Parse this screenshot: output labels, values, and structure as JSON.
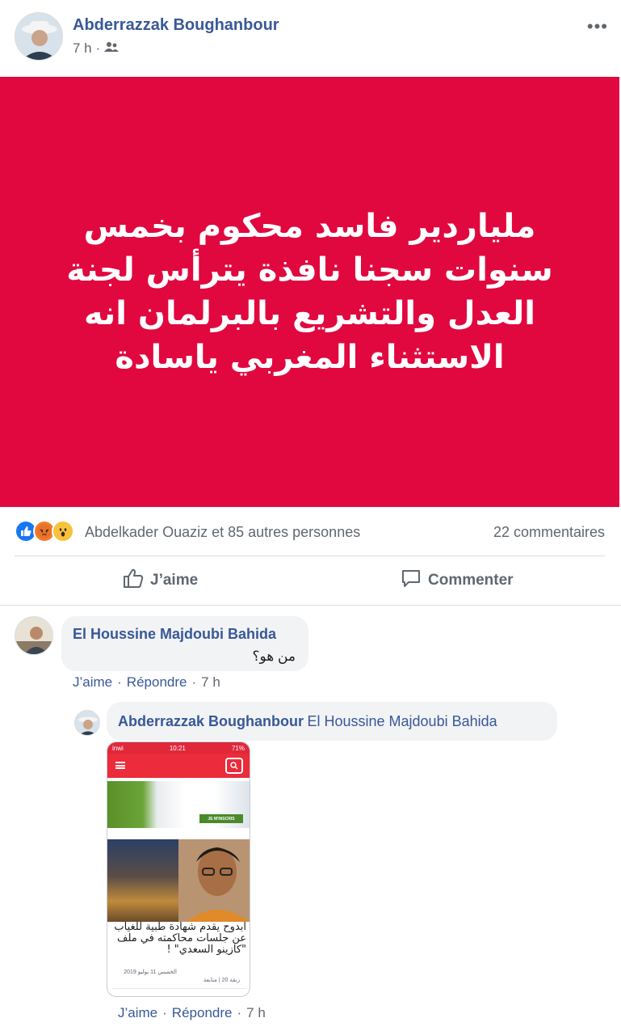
{
  "post": {
    "author": "Abderrazzak Boughanbour",
    "time": "7 h",
    "separator": "·",
    "more_label": "•••",
    "banner_text": "ملياردير فاسد محكوم بخمس سنوات سجنا نافذة يترأس لجنة العدل والتشريع بالبرلمان انه الاستثناء المغربي ياسادة"
  },
  "reactions": {
    "icons": [
      "like-icon",
      "angry-icon",
      "wow-icon"
    ],
    "summary": "Abdelkader Ouaziz et 85 autres personnes",
    "comments_count": "22 commentaires"
  },
  "actions": {
    "like_label": "J’aime",
    "comment_label": "Commenter"
  },
  "comments": [
    {
      "author": "El Houssine Majdoubi Bahida",
      "text": "من هو؟",
      "like": "J’aime",
      "reply": "Répondre",
      "time": "7 h",
      "separator": "·"
    }
  ],
  "reply": {
    "author": "Abderrazzak Boughanbour",
    "tag": "El Houssine Majdoubi Bahida",
    "like": "J’aime",
    "reply": "Répondre",
    "time": "7 h",
    "separator": "·",
    "screenshot": {
      "carrier": "inwi",
      "clock": "10:21",
      "battery": "71%",
      "ad_button": "JE M'INSCRIS",
      "headline": "ابدوح يقدم شهادة طبية للغياب عن جلسات محاكمته في ملف \"كازينو السعدي\" !",
      "date": "الخميس 11 يوليو 2019",
      "source": "زنقة 20 | متابعة"
    }
  },
  "colors": {
    "banner": "#e1083f",
    "link": "#385898",
    "secondary_text": "#606770",
    "bubble": "#f2f3f5"
  }
}
